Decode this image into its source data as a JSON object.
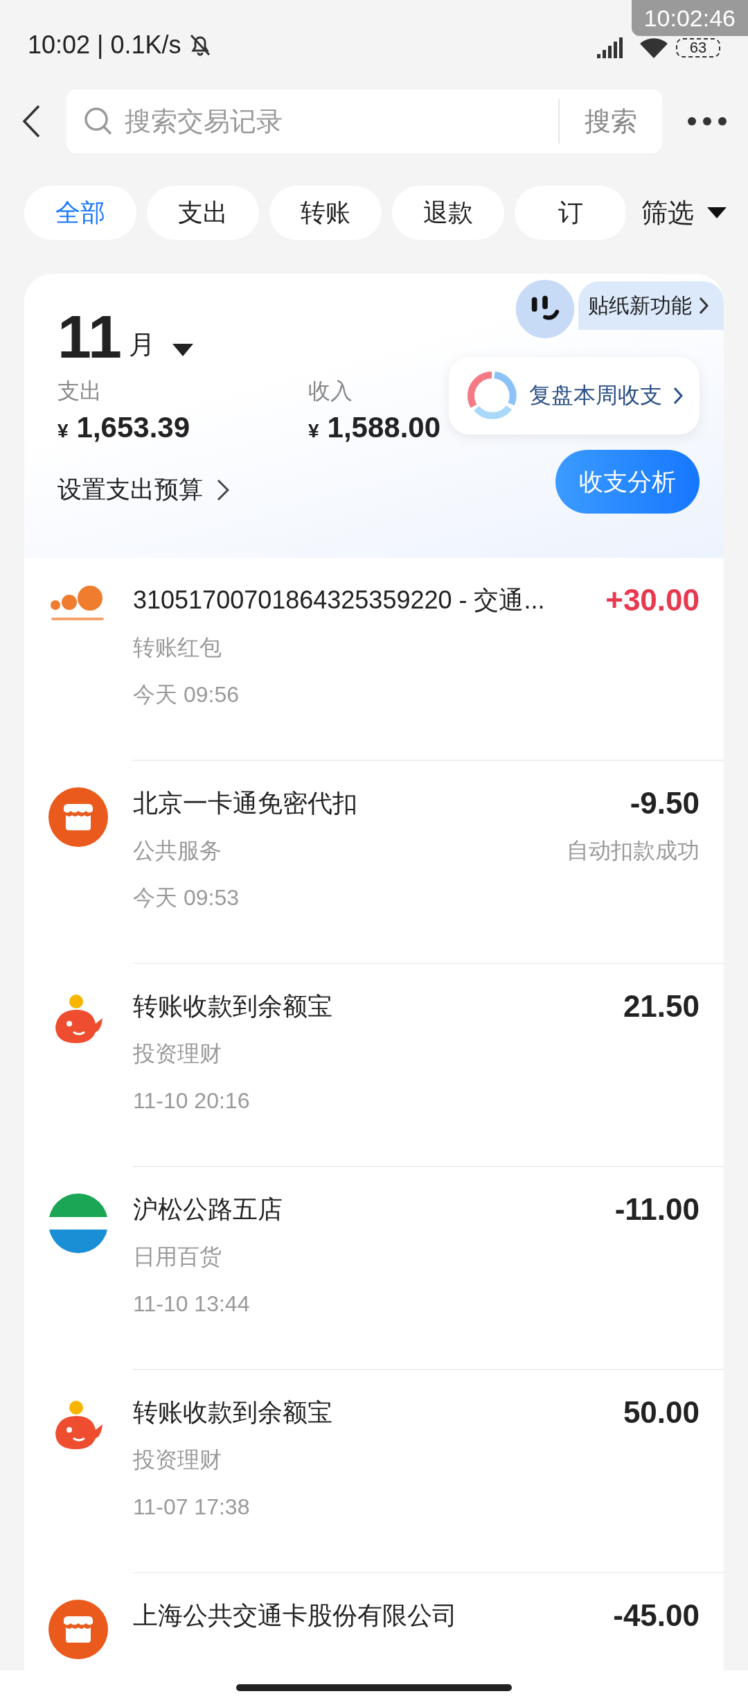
{
  "status_bar": {
    "time": "10:02",
    "divider": "|",
    "speed": "0.1K/s",
    "battery": "63"
  },
  "recording_clock": "10:02:46",
  "search": {
    "placeholder": "搜索交易记录",
    "button": "搜索"
  },
  "tabs": [
    {
      "label": "全部",
      "selected": true
    },
    {
      "label": "支出",
      "selected": false
    },
    {
      "label": "转账",
      "selected": false
    },
    {
      "label": "退款",
      "selected": false
    },
    {
      "label": "订",
      "selected": false
    }
  ],
  "filter": "筛选",
  "summary": {
    "month": "11",
    "month_unit": "月",
    "expense_label": "支出",
    "expense_currency": "¥",
    "expense": "1,653.39",
    "income_label": "收入",
    "income_currency": "¥",
    "income": "1,588.00",
    "budget_link": "设置支出预算",
    "sticker_promo": "贴纸新功能",
    "review_tip": "复盘本周收支",
    "analysis_button": "收支分析"
  },
  "transactions": [
    {
      "kind": "snowball",
      "title": "31051700701864325359220 - 交通...",
      "category": "转账红包",
      "time": "今天 09:56",
      "amount": "+30.00",
      "highlight": true
    },
    {
      "kind": "shop",
      "title": "北京一卡通免密代扣",
      "category": "公共服务",
      "time": "今天 09:53",
      "amount": "-9.50",
      "highlight": false,
      "note": "自动扣款成功"
    },
    {
      "kind": "yuebao",
      "title": "转账收款到余额宝",
      "category": "投资理财",
      "time": "11-10 20:16",
      "amount": "21.50",
      "highlight": false
    },
    {
      "kind": "convenience",
      "title": "沪松公路五店",
      "category": "日用百货",
      "time": "11-10 13:44",
      "amount": "-11.00",
      "highlight": false
    },
    {
      "kind": "yuebao",
      "title": "转账收款到余额宝",
      "category": "投资理财",
      "time": "11-07 17:38",
      "amount": "50.00",
      "highlight": false
    },
    {
      "kind": "shop",
      "title": "上海公共交通卡股份有限公司",
      "amount": "-45.00",
      "highlight": false
    }
  ]
}
